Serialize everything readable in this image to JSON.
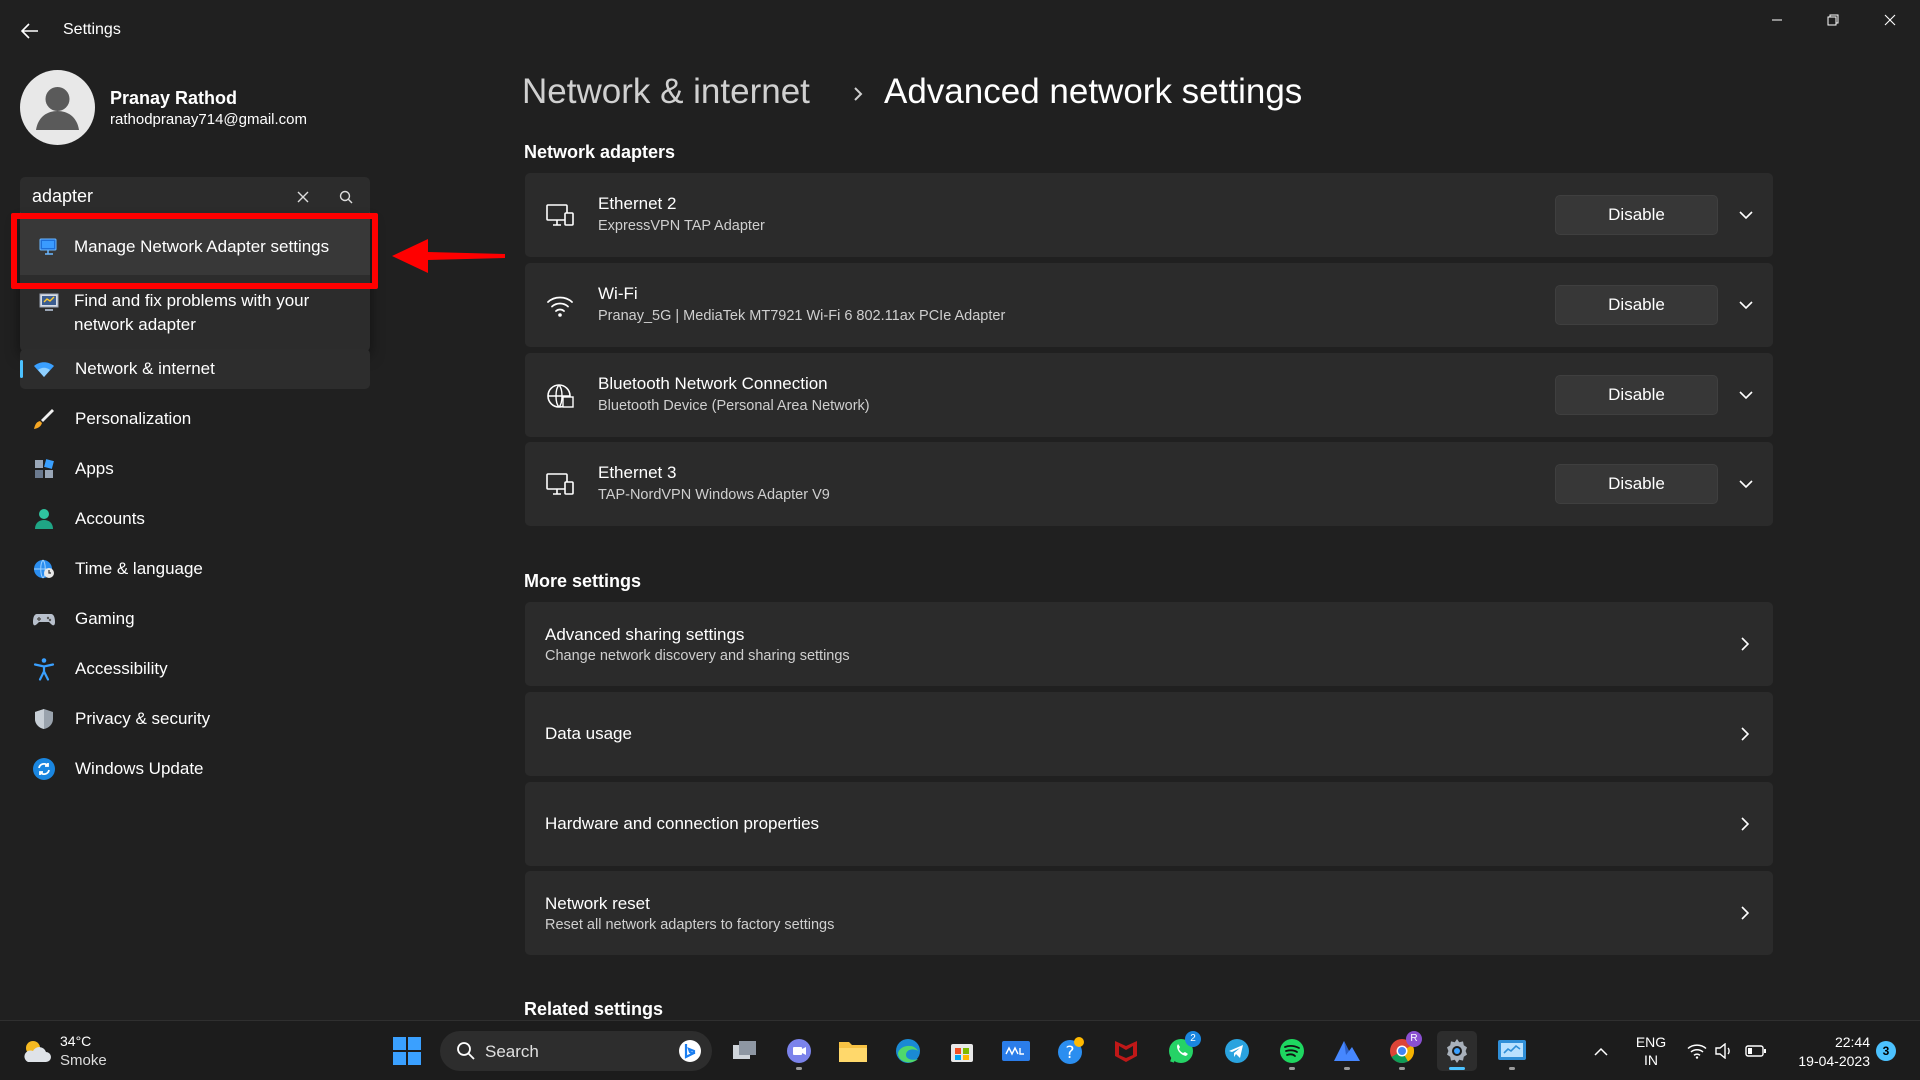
{
  "window": {
    "title": "Settings"
  },
  "profile": {
    "name": "Pranay Rathod",
    "email": "rathodpranay714@gmail.com"
  },
  "search": {
    "value": "adapter",
    "suggestions": [
      {
        "label": "Manage Network Adapter settings"
      },
      {
        "label": "Find and fix problems with your network adapter"
      }
    ]
  },
  "nav": {
    "items": [
      {
        "label": "Network & internet",
        "icon": "wifi-icon",
        "active": true
      },
      {
        "label": "Personalization",
        "icon": "brush-icon"
      },
      {
        "label": "Apps",
        "icon": "apps-icon"
      },
      {
        "label": "Accounts",
        "icon": "person-icon"
      },
      {
        "label": "Time & language",
        "icon": "globe-clock-icon"
      },
      {
        "label": "Gaming",
        "icon": "gamepad-icon"
      },
      {
        "label": "Accessibility",
        "icon": "accessibility-icon"
      },
      {
        "label": "Privacy & security",
        "icon": "shield-icon"
      },
      {
        "label": "Windows Update",
        "icon": "update-icon"
      }
    ]
  },
  "breadcrumb": {
    "parent": "Network & internet",
    "current": "Advanced network settings"
  },
  "adapters": {
    "title": "Network adapters",
    "button_label": "Disable",
    "items": [
      {
        "name": "Ethernet 2",
        "description": "ExpressVPN TAP Adapter",
        "icon": "ethernet-icon"
      },
      {
        "name": "Wi-Fi",
        "description": "Pranay_5G | MediaTek MT7921 Wi-Fi 6 802.11ax PCIe Adapter",
        "icon": "wifi-icon"
      },
      {
        "name": "Bluetooth Network Connection",
        "description": "Bluetooth Device (Personal Area Network)",
        "icon": "globe-icon"
      },
      {
        "name": "Ethernet 3",
        "description": "TAP-NordVPN Windows Adapter V9",
        "icon": "ethernet-icon"
      }
    ]
  },
  "more_settings": {
    "title": "More settings",
    "items": [
      {
        "title": "Advanced sharing settings",
        "subtitle": "Change network discovery and sharing settings"
      },
      {
        "title": "Data usage",
        "subtitle": ""
      },
      {
        "title": "Hardware and connection properties",
        "subtitle": ""
      },
      {
        "title": "Network reset",
        "subtitle": "Reset all network adapters to factory settings"
      }
    ]
  },
  "related_settings": {
    "title": "Related settings"
  },
  "taskbar": {
    "weather": {
      "temp": "34°C",
      "desc": "Smoke"
    },
    "search_label": "Search",
    "apps": [
      {
        "name": "task-view-icon"
      },
      {
        "name": "teams-chat-icon"
      },
      {
        "name": "file-explorer-icon"
      },
      {
        "name": "edge-icon"
      },
      {
        "name": "microsoft-store-icon"
      },
      {
        "name": "mylp-icon"
      },
      {
        "name": "help-icon"
      },
      {
        "name": "mcafee-icon"
      },
      {
        "name": "whatsapp-icon",
        "badge": "2"
      },
      {
        "name": "telegram-icon"
      },
      {
        "name": "spotify-icon"
      },
      {
        "name": "nordvpn-icon"
      },
      {
        "name": "chrome-icon",
        "badge": "R"
      },
      {
        "name": "settings-gear-icon"
      },
      {
        "name": "control-panel-icon"
      }
    ],
    "lang_top": "ENG",
    "lang_bottom": "IN",
    "time": "22:44",
    "date": "19-04-2023",
    "notifications": "3"
  },
  "colors": {
    "accent": "#4cc2ff",
    "highlight": "#ff0000",
    "background": "#202020",
    "card": "#2b2b2b"
  }
}
